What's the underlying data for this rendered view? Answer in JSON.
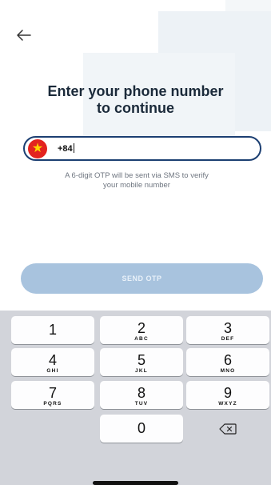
{
  "screen": {
    "title_line1": "Enter your phone number",
    "title_line2": "to continue",
    "helper_text_line1": "A 6-digit OTP will be sent via SMS to verify",
    "helper_text_line2": "your mobile number",
    "send_button_label": "SEND OTP"
  },
  "phone_input": {
    "country_flag": "vietnam-flag-icon",
    "value": "+84"
  },
  "keypad": {
    "keys": [
      {
        "digit": "1",
        "letters": ""
      },
      {
        "digit": "2",
        "letters": "ABC"
      },
      {
        "digit": "3",
        "letters": "DEF"
      },
      {
        "digit": "4",
        "letters": "GHI"
      },
      {
        "digit": "5",
        "letters": "JKL"
      },
      {
        "digit": "6",
        "letters": "MNO"
      },
      {
        "digit": "7",
        "letters": "PQRS"
      },
      {
        "digit": "8",
        "letters": "TUV"
      },
      {
        "digit": "9",
        "letters": "WXYZ"
      },
      {
        "digit": "0",
        "letters": ""
      }
    ],
    "delete_icon": "backspace-icon"
  },
  "colors": {
    "input_border": "#1c3f72",
    "send_button_bg": "#a8c3de",
    "keyboard_bg": "#d2d4da"
  }
}
